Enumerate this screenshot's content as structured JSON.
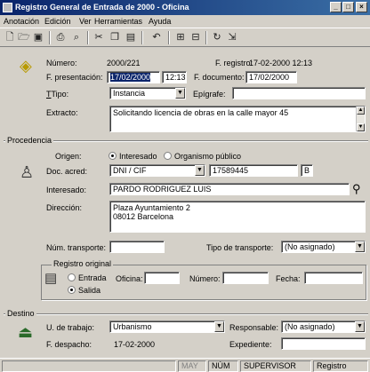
{
  "window": {
    "title": "Registro General de Entrada de 2000 - Oficina"
  },
  "menu": [
    "Anotación",
    "Edición",
    "Ver",
    "Herramientas",
    "Ayuda"
  ],
  "toolbar": {
    "icons": [
      "new-icon",
      "open-icon",
      "save-icon",
      "print-icon",
      "print-preview-icon",
      "cut-icon",
      "copy-icon",
      "paste-icon",
      "undo-icon",
      "register-icon",
      "disk-icon",
      "refresh-icon",
      "export-icon"
    ]
  },
  "header": {
    "numero_label": "Número:",
    "numero_value": "2000/221",
    "f_registro_label": "F. registro:",
    "f_registro_value": "17-02-2000 12:13",
    "f_presentacion_label": "F. presentación:",
    "f_presentacion_date": "17/02/2000",
    "f_presentacion_time": "12:13",
    "f_documento_label": "F. documento:",
    "f_documento_value": "17/02/2000",
    "tipo_label": "Tipo:",
    "tipo_value": "Instancia",
    "epigrafe_label": "Epígrafe:",
    "epigrafe_value": "",
    "extracto_label": "Extracto:",
    "extracto_value": "Solicitando licencia de obras en la calle mayor 45"
  },
  "procedencia": {
    "title": "Procedencia",
    "origen_label": "Origen:",
    "origen_options": [
      "Interesado",
      "Organismo público"
    ],
    "origen_selected": "Interesado",
    "doc_acred_label": "Doc. acred:",
    "doc_tipo": "DNI / CIF",
    "doc_numero": "17589445",
    "doc_letra": "B",
    "interesado_label": "Interesado:",
    "interesado_value": "PARDO RODRIGUEZ LUIS",
    "direccion_label": "Dirección:",
    "direccion_line1": "Plaza Ayuntamiento 2",
    "direccion_line2": "08012 Barcelona",
    "num_transporte_label": "Núm. transporte:",
    "num_transporte_value": "",
    "tipo_transporte_label": "Tipo de transporte:",
    "tipo_transporte_value": "(No asignado)"
  },
  "registro_original": {
    "title": "Registro original",
    "options": [
      "Entrada",
      "Salida"
    ],
    "selected": "Salida",
    "oficina_label": "Oficina:",
    "oficina_value": "",
    "numero_label": "Número:",
    "numero_value": "",
    "fecha_label": "Fecha:",
    "fecha_value": ""
  },
  "destino": {
    "title": "Destino",
    "u_trabajo_label": "U. de trabajo:",
    "u_trabajo_value": "Urbanismo",
    "responsable_label": "Responsable:",
    "responsable_value": "(No asignado)",
    "f_despacho_label": "F. despacho:",
    "f_despacho_value": "17-02-2000",
    "expediente_label": "Expediente:",
    "expediente_value": ""
  },
  "status": {
    "cells": [
      "MAY",
      "NÚM",
      "SUPERVISOR",
      "Registro"
    ]
  }
}
